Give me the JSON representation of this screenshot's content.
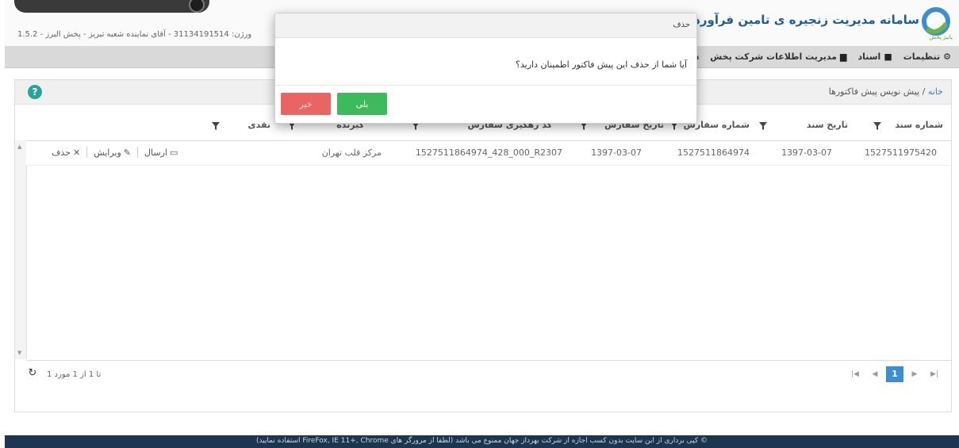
{
  "header": {
    "app_title": "سامانه مدیریت زنجیره ی تامین فرآورده های \"",
    "logo_sub": "پانیژ پخش",
    "user_info": "1.5.2 - ورژن: 31134191514 - آقای نماینده شعبه تبریز - پخش البرز"
  },
  "nav": {
    "items": [
      {
        "icon": "home-icon",
        "label": ""
      },
      {
        "icon": "truck-icon",
        "label": "مدیریت اطلاعات شرکت پخش"
      },
      {
        "icon": "folder-icon",
        "label": "اسناد"
      },
      {
        "icon": "cogs-icon",
        "label": "تنظیمات"
      }
    ]
  },
  "breadcrumb": {
    "home": "خانه",
    "separator": " / ",
    "current": "پیش نویس پیش فاکتورها"
  },
  "grid": {
    "columns": {
      "doc_no": "شماره سند",
      "doc_date": "تاریخ سند",
      "order_no": "شماره سفارش",
      "order_date": "تاریخ سفارش",
      "tracking": "کد رهگیری سفارش",
      "receiver": "گیرنده",
      "cash": "نقدی"
    },
    "rows": [
      {
        "doc_no": "1527511975420",
        "doc_date": "1397-03-07",
        "order_no": "1527511864974",
        "order_date": "1397-03-07",
        "tracking": "1527511864974_428_000_R2307",
        "receiver": "مرکز قلب تهران",
        "send": "ارسال",
        "edit": "ویرایش",
        "delete": "حذف"
      }
    ]
  },
  "pager": {
    "info": "1 تا 1 از 1 مورد",
    "current_page": "1"
  },
  "footer": {
    "text": "© کپی برداری از این سایت بدون کسب اجازه از شرکت بهرداز جهان ممنوع می باشد (لطفا از مرورگر های FireFox, IE 11+, Chrome استفاده نمایید)"
  },
  "dialog": {
    "title": "حذف",
    "message": "آیا شما از حذف این پیش فاکتور اطمینان دارید؟",
    "yes_label": "بلی",
    "no_label": "خیر"
  },
  "colors": {
    "brand": "#1f5e93",
    "yes": "#3dba5c",
    "no": "#e96464",
    "pager_active": "#3a8fd1",
    "footer": "#1e3550"
  }
}
